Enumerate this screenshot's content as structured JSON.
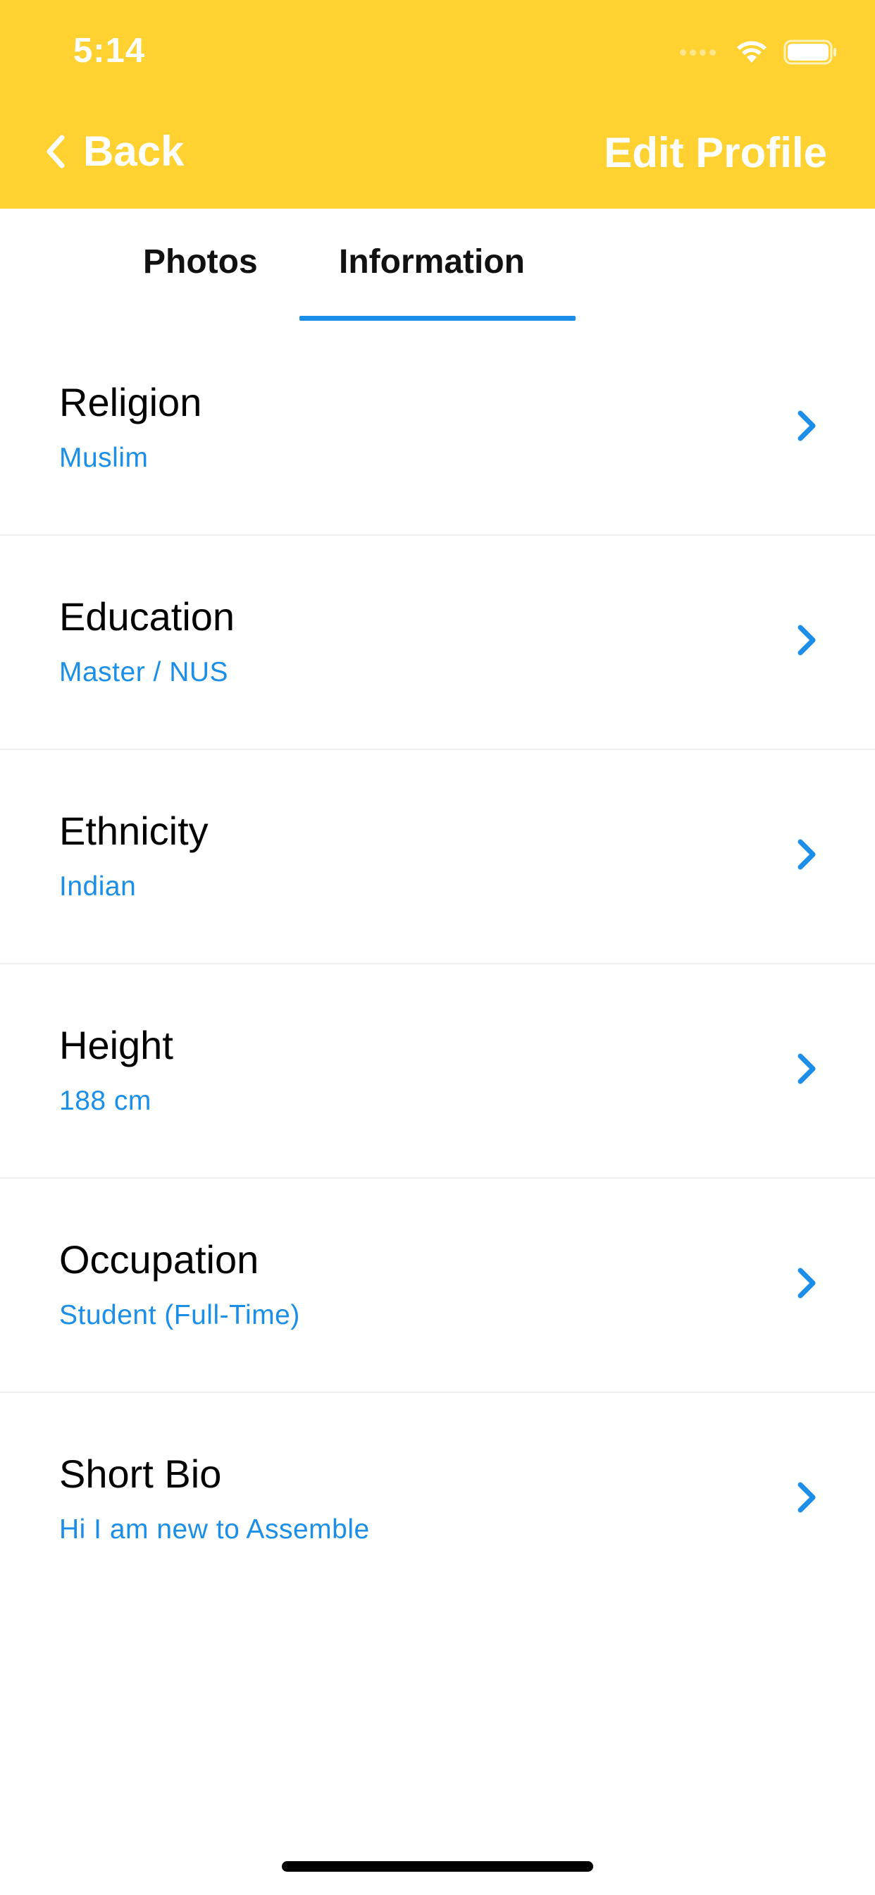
{
  "status_bar": {
    "time": "5:14",
    "icons": [
      "signal-dots-icon",
      "wifi-icon",
      "battery-icon"
    ]
  },
  "nav": {
    "back_label": "Back",
    "title": "Edit Profile",
    "background_color": "#FFD231"
  },
  "tabs": {
    "items": [
      {
        "label": "Photos",
        "selected": false
      },
      {
        "label": "Information",
        "selected": true
      }
    ],
    "accent_color": "#1B8EE8"
  },
  "info_list": [
    {
      "title": "Religion",
      "value": "Muslim"
    },
    {
      "title": "Education",
      "value": "Master / NUS"
    },
    {
      "title": "Ethnicity",
      "value": "Indian"
    },
    {
      "title": "Height",
      "value": "188 cm"
    },
    {
      "title": "Occupation",
      "value": "Student (Full-Time)"
    },
    {
      "title": "Short Bio",
      "value": "Hi I am new to Assemble"
    }
  ]
}
